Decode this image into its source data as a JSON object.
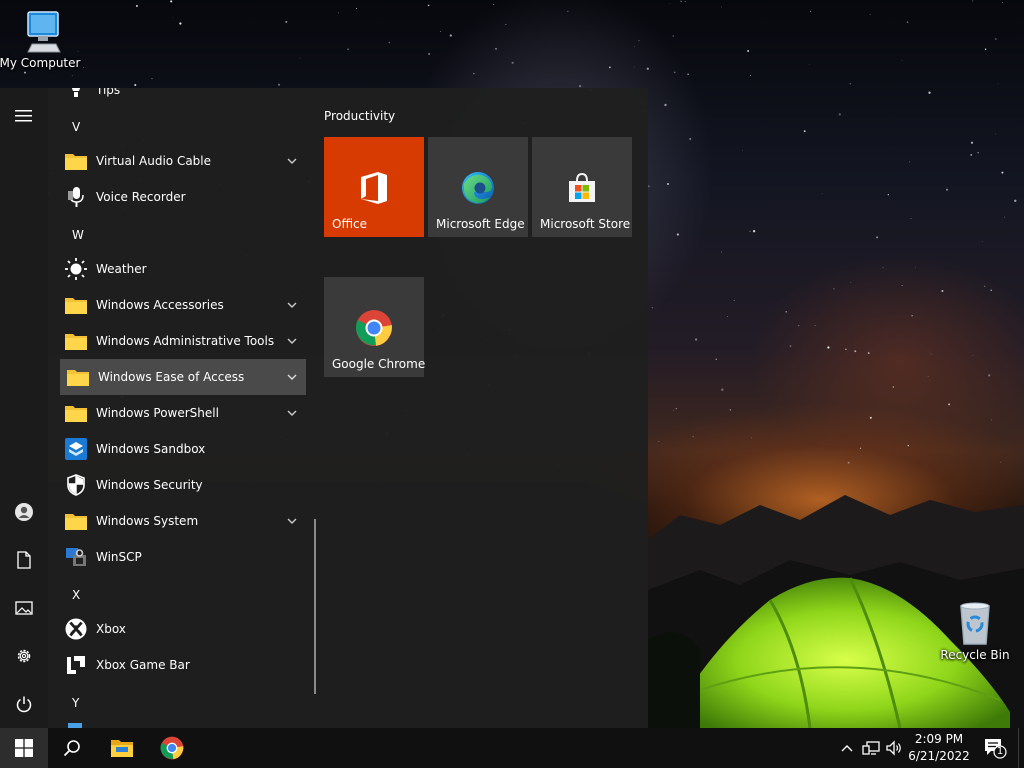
{
  "desktop": {
    "icons": [
      {
        "label": "My Computer",
        "icon": "computer-icon"
      },
      {
        "label": "Recycle Bin",
        "icon": "recycle-bin-icon"
      }
    ]
  },
  "start_menu": {
    "rail": {
      "items": [
        "menu-icon",
        "user-icon",
        "documents-icon",
        "pictures-icon",
        "settings-icon",
        "power-icon"
      ]
    },
    "app_list": {
      "items": [
        {
          "type": "app",
          "label": "Tips",
          "icon": "tips-icon"
        },
        {
          "type": "letter",
          "label": "V"
        },
        {
          "type": "folder",
          "label": "Virtual Audio Cable",
          "icon": "folder-icon"
        },
        {
          "type": "app",
          "label": "Voice Recorder",
          "icon": "microphone-icon"
        },
        {
          "type": "letter",
          "label": "W"
        },
        {
          "type": "app",
          "label": "Weather",
          "icon": "sun-icon"
        },
        {
          "type": "folder",
          "label": "Windows Accessories",
          "icon": "folder-icon"
        },
        {
          "type": "folder",
          "label": "Windows Administrative Tools",
          "icon": "folder-icon"
        },
        {
          "type": "folder",
          "label": "Windows Ease of Access",
          "icon": "folder-icon",
          "selected": true
        },
        {
          "type": "folder",
          "label": "Windows PowerShell",
          "icon": "folder-icon"
        },
        {
          "type": "app",
          "label": "Windows Sandbox",
          "icon": "sandbox-icon"
        },
        {
          "type": "app",
          "label": "Windows Security",
          "icon": "shield-icon"
        },
        {
          "type": "folder",
          "label": "Windows System",
          "icon": "folder-icon"
        },
        {
          "type": "app",
          "label": "WinSCP",
          "icon": "winscp-icon"
        },
        {
          "type": "letter",
          "label": "X"
        },
        {
          "type": "app",
          "label": "Xbox",
          "icon": "xbox-icon"
        },
        {
          "type": "app",
          "label": "Xbox Game Bar",
          "icon": "xbox-game-bar-icon"
        },
        {
          "type": "letter",
          "label": "Y"
        }
      ]
    },
    "tiles": {
      "group_title": "Productivity",
      "items": [
        {
          "label": "Office",
          "icon": "office-icon",
          "color": "#d83b01"
        },
        {
          "label": "Microsoft Edge",
          "icon": "edge-icon",
          "color": "#3a3a3a"
        },
        {
          "label": "Microsoft Store",
          "icon": "store-icon",
          "color": "#3a3a3a"
        },
        {
          "label": "Google Chrome",
          "icon": "chrome-icon",
          "color": "#3a3a3a"
        }
      ]
    }
  },
  "taskbar": {
    "pinned": [
      "windows-start-icon",
      "search-icon",
      "file-explorer-icon",
      "chrome-icon"
    ],
    "tray": [
      "chevron-up-icon",
      "network-icon",
      "volume-icon"
    ],
    "clock": {
      "time": "2:09 PM",
      "date": "6/21/2022"
    },
    "notifications": {
      "count": "1"
    }
  },
  "colors": {
    "accent": "#d83b01",
    "menu_bg": "#1f1f1f",
    "taskbar_bg": "#101010",
    "selected_row": "#4a4a4a",
    "folder": "#f2c234"
  }
}
